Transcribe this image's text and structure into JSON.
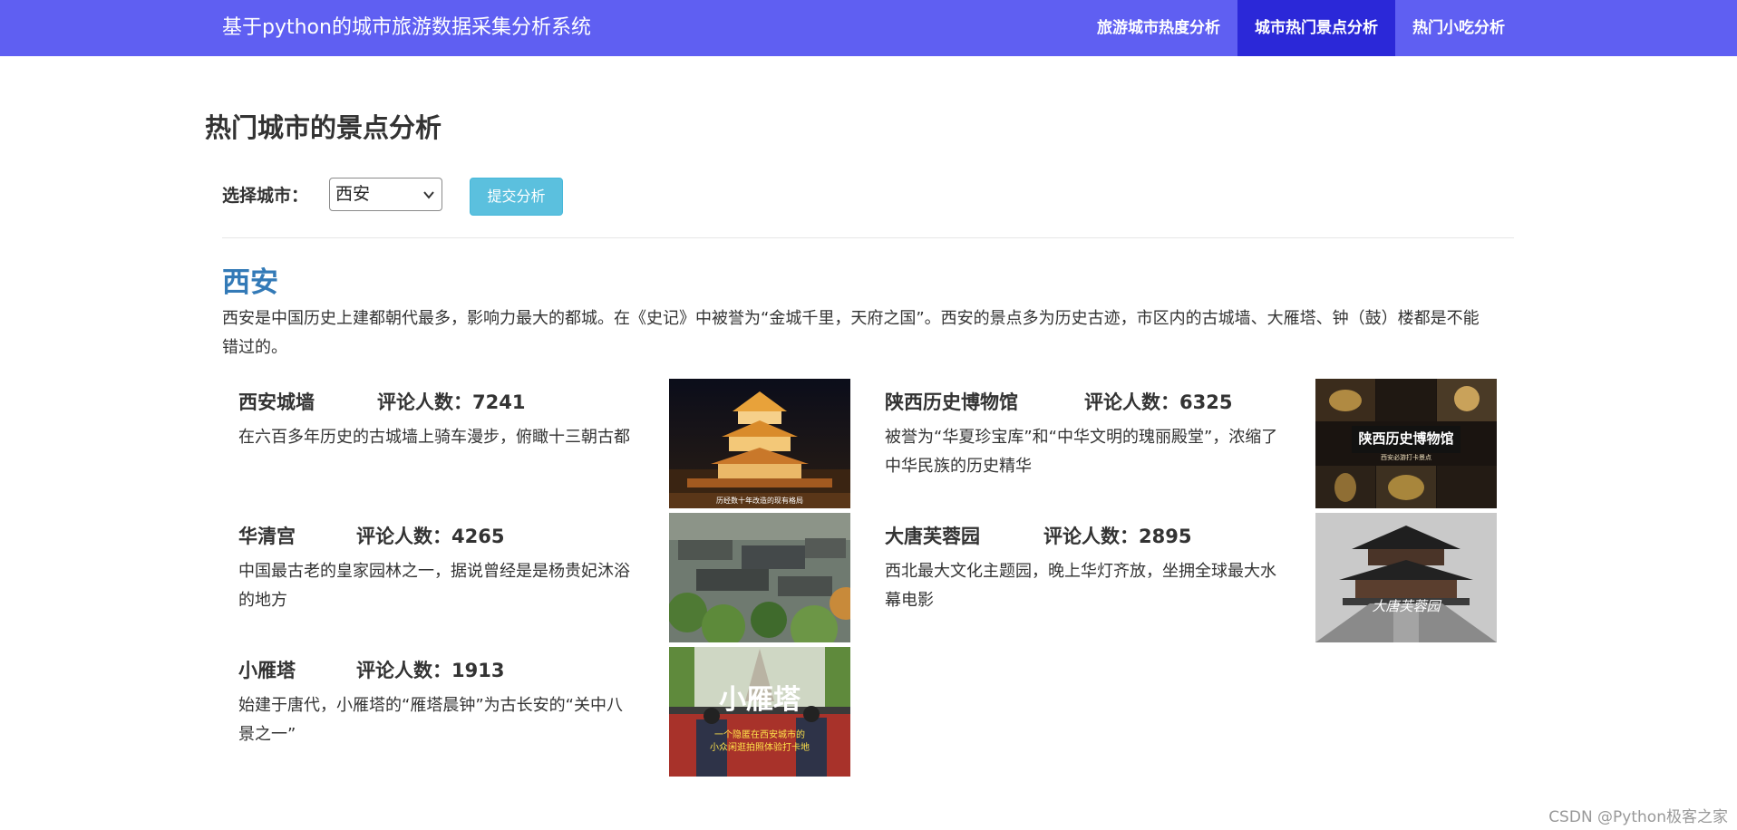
{
  "navbar": {
    "brand": "基于python的城市旅游数据采集分析系统",
    "items": [
      {
        "label": "旅游城市热度分析",
        "active": false
      },
      {
        "label": "城市热门景点分析",
        "active": true
      },
      {
        "label": "热门小吃分析",
        "active": false
      }
    ],
    "color": "#5f5ff2",
    "active_color": "#2b28d8"
  },
  "page": {
    "title": "热门城市的景点分析"
  },
  "filter": {
    "label": "选择城市：",
    "selected_city": "西安",
    "submit_label": "提交分析"
  },
  "city": {
    "name": "西安",
    "description": "西安是中国历史上建都朝代最多，影响力最大的都城。在《史记》中被誉为“金城千里，天府之国”。西安的景点多为历史古迹，市区内的古城墙、大雁塔、钟（鼓）楼都是不能错过的。"
  },
  "attractions": [
    {
      "name": "西安城墙",
      "count_label": "评论人数：7241",
      "description": "在六百多年历史的古城墙上骑车漫步，俯瞰十三朝古都",
      "image_icon": "city-wall-night-photo-icon",
      "image_caption": "历经数十年改造的现有格局"
    },
    {
      "name": "陕西历史博物馆",
      "count_label": "评论人数：6325",
      "description": "被誉为“华夏珍宝库”和“中华文明的瑰丽殿堂”，浓缩了中华民族的历史精华",
      "image_icon": "museum-artifacts-photo-icon",
      "image_title": "陕西历史博物馆",
      "image_subtitle": "西安必游打卡景点"
    },
    {
      "name": "华清宫",
      "count_label": "评论人数：4265",
      "description": "中国最古老的皇家园林之一，据说曾经是是杨贵妃沐浴的地方",
      "image_icon": "palace-aerial-photo-icon"
    },
    {
      "name": "大唐芙蓉园",
      "count_label": "评论人数：2895",
      "description": "西北最大文化主题园，晚上华灯齐放，坐拥全球最大水幕电影",
      "image_icon": "tang-park-pavilion-photo-icon",
      "image_title": "大唐芙蓉园"
    },
    {
      "name": "小雁塔",
      "count_label": "评论人数：1913",
      "description": "始建于唐代，小雁塔的“雁塔晨钟”为古长安的“关中八景之一”",
      "image_icon": "small-goose-pagoda-photo-icon",
      "image_title": "小雁塔",
      "image_subtitle": "一个隐匿在西安城市的",
      "image_subtitle2": "小众闲逛拍照体验打卡地"
    }
  ],
  "watermark": "CSDN @Python极客之家"
}
